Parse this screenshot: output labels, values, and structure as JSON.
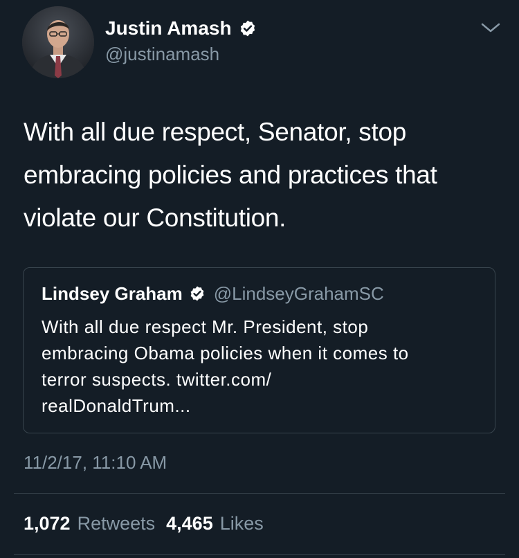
{
  "colors": {
    "background": "#141d26",
    "primary_text": "#ffffff",
    "secondary_text": "#8899a6",
    "border": "#38444d"
  },
  "tweet": {
    "author": {
      "name": "Justin Amash",
      "handle": "@justinamash",
      "verified": true,
      "avatar_icon": "profile-photo"
    },
    "menu_icon": "chevron-down-icon",
    "text": "With all due respect, Senator, stop\nembracing policies and practices that\nviolate our Constitution.",
    "quoted": {
      "name": "Lindsey Graham",
      "handle": "@LindseyGrahamSC",
      "verified": true,
      "text": "With all due respect Mr. President, stop\nembracing Obama policies when it comes to\nterror suspects. twitter.com/\nrealDonaldTrum..."
    },
    "timestamp": "11/2/17, 11:10 AM",
    "stats": {
      "retweets_count": "1,072",
      "retweets_label": "Retweets",
      "likes_count": "4,465",
      "likes_label": "Likes"
    }
  }
}
